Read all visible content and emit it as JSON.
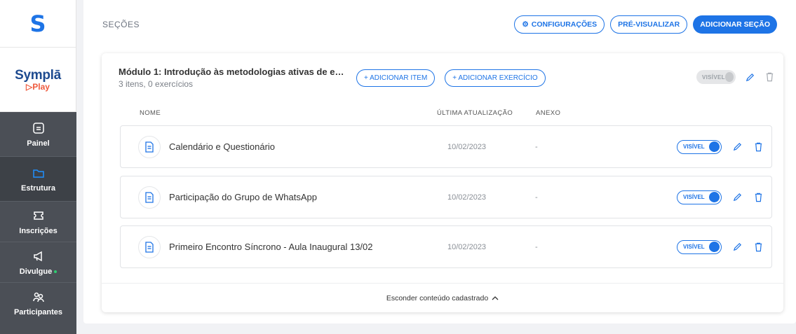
{
  "sidebar": {
    "logo_mark": "S",
    "brand_name": "Symplā",
    "brand_sub": "Play",
    "items": [
      {
        "label": "Painel",
        "icon": "document-icon"
      },
      {
        "label": "Estrutura",
        "icon": "folder-icon"
      },
      {
        "label": "Inscrições",
        "icon": "ticket-icon"
      },
      {
        "label": "Divulgue",
        "icon": "megaphone-icon"
      },
      {
        "label": "Participantes",
        "icon": "users-icon"
      }
    ]
  },
  "header": {
    "title": "SEÇÕES",
    "config_label": "CONFIGURAÇÕES",
    "preview_label": "PRÉ-VISUALIZAR",
    "add_section_label": "ADICIONAR SEÇÃO"
  },
  "module": {
    "title": "Módulo 1: Introdução às metodologias ativas de en...",
    "subtitle": "3 itens, 0 exercícios",
    "add_item_label": "+ ADICIONAR ITEM",
    "add_exercise_label": "+ ADICIONAR EXERCÍCIO",
    "visibility_label": "VISÍVEL"
  },
  "table": {
    "columns": {
      "name": "NOME",
      "updated": "ÚLTIMA ATUALIZAÇÃO",
      "attachment": "ANEXO"
    },
    "rows": [
      {
        "name": "Calendário e Questionário",
        "date": "10/02/2023",
        "attachment": "-",
        "visibility": "VISÍVEL"
      },
      {
        "name": "Participação do Grupo de WhatsApp",
        "date": "10/02/2023",
        "attachment": "-",
        "visibility": "VISÍVEL"
      },
      {
        "name": "Primeiro Encontro Síncrono - Aula Inaugural 13/02",
        "date": "10/02/2023",
        "attachment": "-",
        "visibility": "VISÍVEL"
      }
    ]
  },
  "footer": {
    "hide_label": "Esconder conteúdo cadastrado"
  },
  "colors": {
    "accent": "#1e74e6",
    "sidebar_dark": "#4b4f56",
    "brand_orange": "#ef5b3e"
  }
}
